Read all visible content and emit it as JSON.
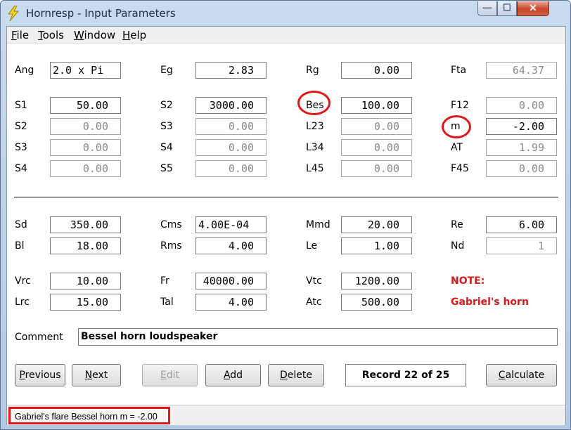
{
  "window": {
    "title": "Hornresp - Input Parameters",
    "controls": {
      "minimize": "—",
      "maximize": "☐",
      "close": "✕"
    }
  },
  "menu": [
    {
      "accel": "F",
      "rest": "ile"
    },
    {
      "accel": "T",
      "rest": "ools"
    },
    {
      "accel": "W",
      "rest": "indow"
    },
    {
      "accel": "H",
      "rest": "elp"
    }
  ],
  "fields": {
    "ang": {
      "label": "Ang",
      "value": "2.0 x Pi"
    },
    "eg": {
      "label": "Eg",
      "value": "2.83"
    },
    "rg": {
      "label": "Rg",
      "value": "0.00"
    },
    "fta": {
      "label": "Fta",
      "value": "64.37"
    },
    "s1": {
      "label": "S1",
      "value": "50.00"
    },
    "s2_top": {
      "label": "S2",
      "value": "3000.00"
    },
    "bes": {
      "label": "Bes",
      "value": "100.00"
    },
    "f12": {
      "label": "F12",
      "value": "0.00"
    },
    "s2": {
      "label": "S2",
      "value": "0.00"
    },
    "s3_mid": {
      "label": "S3",
      "value": "0.00"
    },
    "l23": {
      "label": "L23",
      "value": "0.00"
    },
    "m": {
      "label": "m",
      "value": "-2.00"
    },
    "s3": {
      "label": "S3",
      "value": "0.00"
    },
    "s4_mid": {
      "label": "S4",
      "value": "0.00"
    },
    "l34": {
      "label": "L34",
      "value": "0.00"
    },
    "at": {
      "label": "AT",
      "value": "1.99"
    },
    "s4": {
      "label": "S4",
      "value": "0.00"
    },
    "s5": {
      "label": "S5",
      "value": "0.00"
    },
    "l45": {
      "label": "L45",
      "value": "0.00"
    },
    "f45": {
      "label": "F45",
      "value": "0.00"
    },
    "sd": {
      "label": "Sd",
      "value": "350.00"
    },
    "cms": {
      "label": "Cms",
      "value": "4.00E-04"
    },
    "mmd": {
      "label": "Mmd",
      "value": "20.00"
    },
    "re": {
      "label": "Re",
      "value": "6.00"
    },
    "bl": {
      "label": "Bl",
      "value": "18.00"
    },
    "rms": {
      "label": "Rms",
      "value": "4.00"
    },
    "le": {
      "label": "Le",
      "value": "1.00"
    },
    "nd": {
      "label": "Nd",
      "value": "1"
    },
    "vrc": {
      "label": "Vrc",
      "value": "10.00"
    },
    "fr": {
      "label": "Fr",
      "value": "40000.00"
    },
    "vtc": {
      "label": "Vtc",
      "value": "1200.00"
    },
    "lrc": {
      "label": "Lrc",
      "value": "15.00"
    },
    "tal": {
      "label": "Tal",
      "value": "4.00"
    },
    "atc": {
      "label": "Atc",
      "value": "500.00"
    }
  },
  "note": {
    "label": "NOTE:",
    "text": "Gabriel's horn"
  },
  "comment": {
    "label": "Comment",
    "value": "Bessel horn loudspeaker"
  },
  "buttons": {
    "previous": {
      "accel": "P",
      "rest": "revious"
    },
    "next": {
      "accel": "N",
      "rest": "ext"
    },
    "edit": {
      "accel": "E",
      "rest": "dit"
    },
    "add": {
      "accel": "A",
      "rest": "dd"
    },
    "delete": {
      "accel": "D",
      "rest": "elete"
    },
    "calculate": {
      "accel": "C",
      "rest": "alculate"
    }
  },
  "record": "Record 22 of 25",
  "status": "Gabriel's flare Bessel horn  m = -2.00",
  "colors": {
    "highlight": "#e01818",
    "note_text": "#d51a1a"
  },
  "icons": {
    "app": "lightning-bolt-icon"
  }
}
